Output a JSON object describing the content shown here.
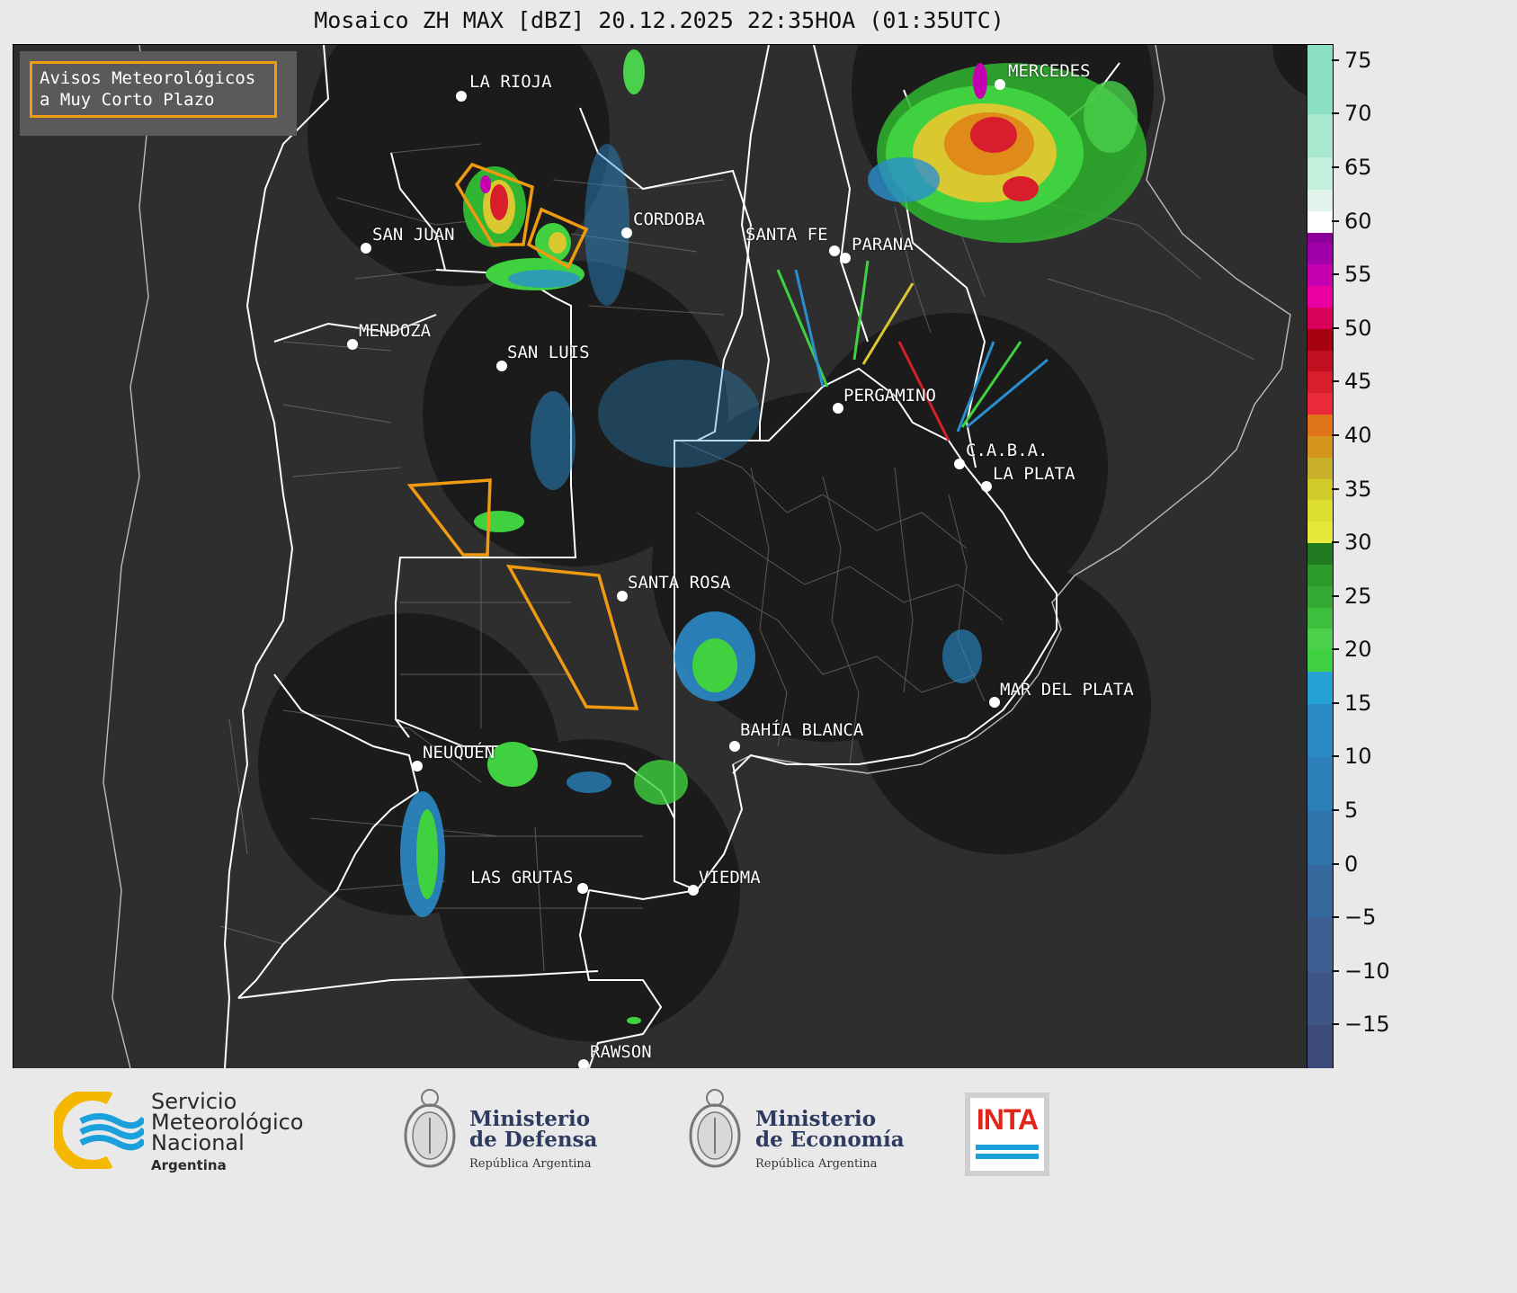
{
  "title": "Mosaico ZH MAX [dBZ] 20.12.2025 22:35HOA (01:35UTC)",
  "legend_box": {
    "line1": "Avisos Meteorológicos",
    "line2": "a Muy Corto Plazo",
    "border_color": "#f09a10"
  },
  "cities": [
    {
      "name": "LA RIOJA"
    },
    {
      "name": "MERCEDES"
    },
    {
      "name": "SAN JUAN"
    },
    {
      "name": "CORDOBA"
    },
    {
      "name": "SANTA FE"
    },
    {
      "name": "PARANA"
    },
    {
      "name": "MENDOZA"
    },
    {
      "name": "SAN LUIS"
    },
    {
      "name": "PERGAMINO"
    },
    {
      "name": "C.A.B.A."
    },
    {
      "name": "LA PLATA"
    },
    {
      "name": "SANTA ROSA"
    },
    {
      "name": "MAR DEL PLATA"
    },
    {
      "name": "BAHÍA BLANCA"
    },
    {
      "name": "NEUQUÉN"
    },
    {
      "name": "LAS GRUTAS"
    },
    {
      "name": "VIEDMA"
    },
    {
      "name": "RAWSON"
    }
  ],
  "colorbar": {
    "unit": "dBZ",
    "ticks": [
      "75",
      "70",
      "65",
      "60",
      "55",
      "50",
      "45",
      "40",
      "35",
      "30",
      "25",
      "20",
      "15",
      "10",
      "5",
      "0",
      "−5",
      "−10",
      "−15"
    ],
    "range": [
      -19,
      76.5
    ]
  },
  "footer": {
    "smn": {
      "line1": "Servicio",
      "line2": "Meteorológico",
      "line3": "Nacional",
      "line4": "Argentina"
    },
    "defensa": {
      "line1": "Ministerio",
      "line2": "de Defensa",
      "line3": "República Argentina"
    },
    "economia": {
      "line1": "Ministerio",
      "line2": "de Economía",
      "line3": "República Argentina"
    },
    "inta": {
      "text": "INTA"
    }
  },
  "colors": {
    "map_bg": "#2e2e2e",
    "radar_disc": "#1b1b1b",
    "warning": "#f09a10",
    "smn_blue": "#1aa0db",
    "smn_yellow": "#f5b800",
    "inta_red": "#e0251b"
  }
}
